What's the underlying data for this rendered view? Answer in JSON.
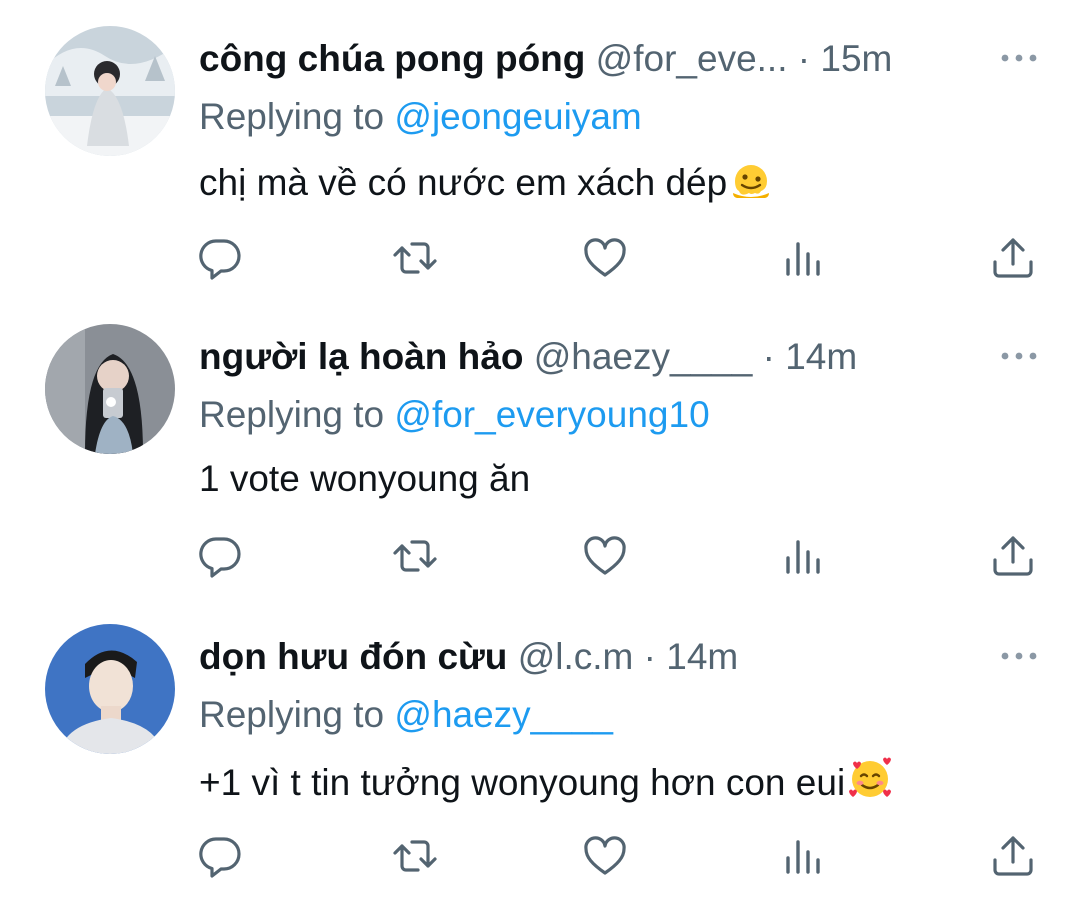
{
  "tweets": [
    {
      "name": "công chúa pong póng",
      "handle": "@for_eve...",
      "dot": "·",
      "time": "15m",
      "replying_prefix": "Replying to",
      "replying_to": "@jeongeuiyam",
      "text": "chị mà về có nước em xách dép",
      "emoji": "melting-face-emoji",
      "avatar_colors": {
        "bg": "#c9d4dc",
        "accent": "#e9eef2",
        "figure": "#2a2a2e"
      }
    },
    {
      "name": "người lạ hoàn hảo",
      "handle": "@haezy____",
      "dot": "·",
      "time": "14m",
      "replying_prefix": "Replying to",
      "replying_to": "@for_everyoung10",
      "text": "1 vote wonyoung ăn",
      "emoji": "",
      "avatar_colors": {
        "bg": "#8a8f96",
        "accent": "#c7cbd1",
        "figure": "#1e2024"
      }
    },
    {
      "name": "dọn hưu đón cừu",
      "handle": "@l.c.m",
      "dot": "·",
      "time": "14m",
      "replying_prefix": "Replying to",
      "replying_to": "@haezy____",
      "text": "+1 vì t tin tưởng wonyoung hơn con eui",
      "emoji": "smiling-face-with-hearts-emoji",
      "avatar_colors": {
        "bg": "#3f74c4",
        "accent": "#f1e2d6",
        "figure": "#1a1a1a"
      }
    }
  ],
  "action_icons": [
    "reply-icon",
    "retweet-icon",
    "like-icon",
    "views-icon",
    "share-icon"
  ],
  "colors": {
    "text": "#0f1419",
    "secondary": "#536471",
    "link": "#1d9bf0"
  }
}
